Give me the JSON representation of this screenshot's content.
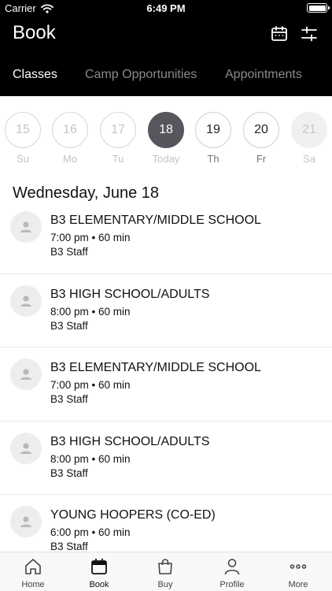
{
  "status_bar": {
    "carrier": "Carrier",
    "time": "6:49 PM"
  },
  "header": {
    "title": "Book",
    "icons": [
      "calendar-icon",
      "filter-sliders-icon"
    ],
    "tabs": [
      {
        "label": "Classes",
        "active": true
      },
      {
        "label": "Camp Opportunities",
        "active": false
      },
      {
        "label": "Appointments",
        "active": false
      }
    ]
  },
  "days": [
    {
      "num": "15",
      "dow": "Su",
      "state": "past"
    },
    {
      "num": "16",
      "dow": "Mo",
      "state": "past"
    },
    {
      "num": "17",
      "dow": "Tu",
      "state": "past"
    },
    {
      "num": "18",
      "dow": "Today",
      "state": "selected"
    },
    {
      "num": "19",
      "dow": "Th",
      "state": "future"
    },
    {
      "num": "20",
      "dow": "Fr",
      "state": "future"
    },
    {
      "num": "21",
      "dow": "Sa",
      "state": "disabled"
    }
  ],
  "date_heading": "Wednesday, June 18",
  "classes": [
    {
      "name": "B3 ELEMENTARY/MIDDLE SCHOOL",
      "time": "7:00 pm • 60 min",
      "staff": "B3 Staff"
    },
    {
      "name": "B3 HIGH SCHOOL/ADULTS",
      "time": "8:00 pm • 60 min",
      "staff": "B3 Staff"
    },
    {
      "name": "B3 ELEMENTARY/MIDDLE SCHOOL",
      "time": "7:00 pm • 60 min",
      "staff": "B3 Staff"
    },
    {
      "name": "B3 HIGH SCHOOL/ADULTS",
      "time": "8:00 pm • 60 min",
      "staff": "B3 Staff"
    },
    {
      "name": "YOUNG HOOPERS (CO-ED)",
      "time": "6:00 pm • 60 min",
      "staff": "B3 Staff"
    }
  ],
  "tab_bar": [
    {
      "label": "Home",
      "icon": "home-icon",
      "active": false
    },
    {
      "label": "Book",
      "icon": "calendar-icon",
      "active": true
    },
    {
      "label": "Buy",
      "icon": "shopping-bag-icon",
      "active": false
    },
    {
      "label": "Profile",
      "icon": "person-icon",
      "active": false
    },
    {
      "label": "More",
      "icon": "more-dots-icon",
      "active": false
    }
  ]
}
